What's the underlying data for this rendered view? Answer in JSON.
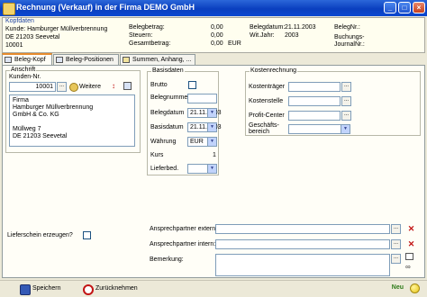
{
  "window": {
    "title": "Rechnung (Verkauf) in der Firma DEMO GmbH",
    "buttons": [
      "_",
      "□",
      "×"
    ]
  },
  "header": {
    "section_label": "Kopfdaten",
    "customer_line": "Kunde: Hamburger Müllverbrennung",
    "zip_city": "DE 21203 Seevetal",
    "number": "10001",
    "belegbetrag_label": "Belegbetrag:",
    "belegbetrag_value": "0,00",
    "steuern_label": "Steuern:",
    "steuern_value": "0,00",
    "gesamt_label": "Gesamtbetrag:",
    "gesamt_value": "0,00",
    "currency": "EUR",
    "belegdatum_label": "Belegdatum:",
    "belegdatum_value": "21.11.2003",
    "wjahr_label": "Wit.Jahr:",
    "wjahr_value": "2003",
    "belegnr_label": "BelegNr.:",
    "journalnr_label": "Buchungs-JournalNr.:"
  },
  "tabs": [
    {
      "label": "Beleg-Kopf",
      "active": true
    },
    {
      "label": "Beleg-Positionen",
      "active": false
    },
    {
      "label": "Summen, Anhang, ...",
      "active": false
    }
  ],
  "anschrift": {
    "title": "Anschrift",
    "kunden_label": "Kunden-Nr.",
    "kunden_value": "10001",
    "weitere_label": "Weitere",
    "address_lines": [
      "Firma",
      "Hamburger Müllverbrennung",
      "GmbH & Co. KG",
      "",
      "Müllweg 7",
      "DE 21203 Seevetal"
    ]
  },
  "basisdaten": {
    "title": "Basisdaten",
    "brutto_label": "Brutto",
    "belegnummer_label": "Belegnummer",
    "belegnummer_value": "",
    "belegdatum_label": "Belegdatum",
    "belegdatum_value": "21.11.2003",
    "basisdatum_label": "Basisdatum",
    "basisdatum_value": "21.11.2003",
    "waehrung_label": "Währung",
    "waehrung_value": "EUR",
    "kurs_label": "Kurs",
    "kurs_value": "1",
    "lieferbed_label": "Lieferbed.",
    "lieferbed_value": ""
  },
  "kostenrechnung": {
    "title": "Kostenrechnung",
    "kostentraeger_label": "Kostenträger",
    "kostenstelle_label": "Kostenstelle",
    "profitcenter_label": "Profit-Center",
    "geschaeftsbereich_label_1": "Geschäfts-",
    "geschaeftsbereich_label_2": "bereich"
  },
  "lieferschein_label": "Lieferschein erzeugen?",
  "ansprech_extern_label": "Ansprechpartner extern:",
  "ansprech_intern_label": "Ansprechpartner intern:",
  "bemerkung_label": "Bemerkung:",
  "bottom": {
    "save_label": "Speichern",
    "undo_label": "Zurücknehmen",
    "status": "Neu"
  }
}
